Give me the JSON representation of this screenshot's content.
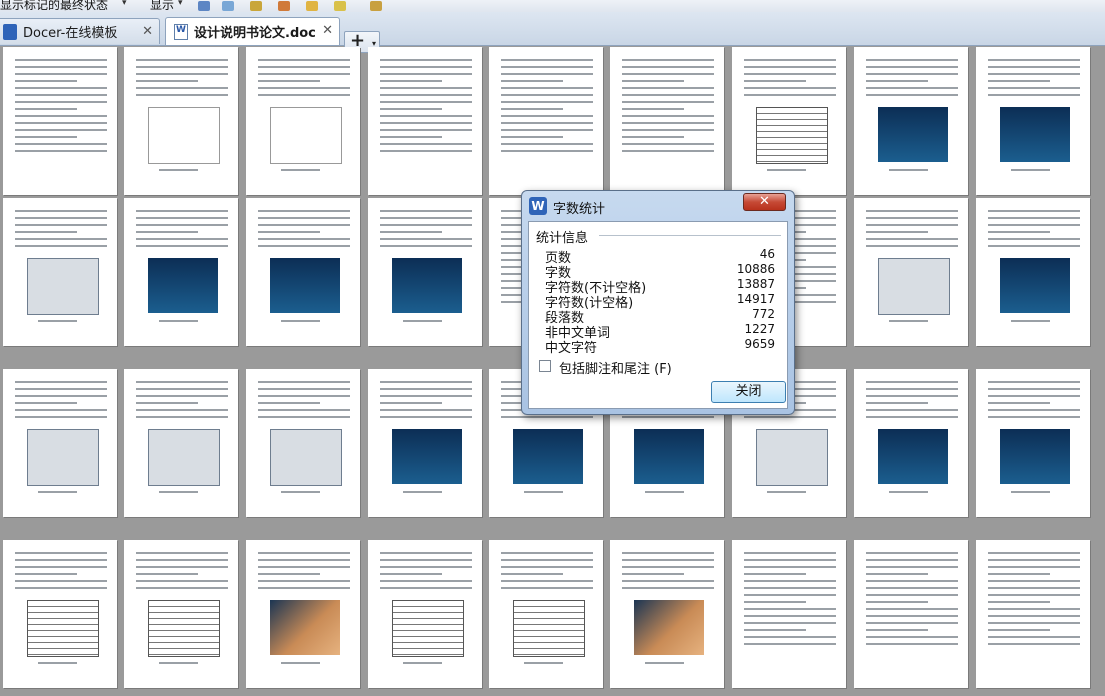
{
  "toolbar": {
    "markup_view": "显示标记的最终状态",
    "show_menu": "显示"
  },
  "tabs": [
    {
      "label": "Docer-在线模板",
      "active": false
    },
    {
      "label": "设计说明书论文.doc",
      "active": true
    }
  ],
  "new_tab_symbol": "+",
  "dialog": {
    "title": "字数统计",
    "icon_letter": "W",
    "close_glyph": "✕",
    "group_title": "统计信息",
    "stats": [
      {
        "label": "页数",
        "value": "46"
      },
      {
        "label": "字数",
        "value": "10886"
      },
      {
        "label": "字符数(不计空格)",
        "value": "13887"
      },
      {
        "label": "字符数(计空格)",
        "value": "14917"
      },
      {
        "label": "段落数",
        "value": "772"
      },
      {
        "label": "非中文单词",
        "value": "1227"
      },
      {
        "label": "中文字符",
        "value": "9659"
      }
    ],
    "checkbox_label": "包括脚注和尾注 (F)",
    "checkbox_checked": false,
    "close_button": "关闭"
  },
  "colors": {
    "background": "#9a9a9a",
    "page": "#ffffff",
    "dialog_frame": "#a9c3e3",
    "close_red": "#c64a36"
  }
}
